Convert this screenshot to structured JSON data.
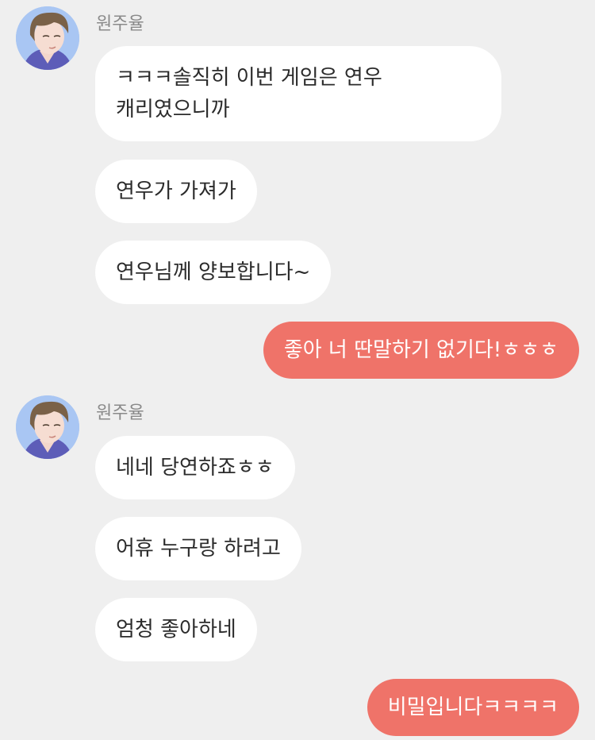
{
  "theme": {
    "background": "#efefef",
    "incoming_bubble": "#ffffff",
    "outgoing_bubble": "#ef7369",
    "sender_name_color": "#8a8a8a"
  },
  "groups": [
    {
      "sender": "원주율",
      "avatar_icon": "male-character-avatar",
      "messages": [
        "ㅋㅋㅋ솔직히 이번 게임은 연우 캐리였으니까",
        "연우가 가져가",
        "연우님께 양보합니다~"
      ]
    },
    {
      "sender": "원주율",
      "avatar_icon": "male-character-avatar",
      "messages": [
        "네네 당연하죠ㅎㅎ",
        "어휴 누구랑 하려고",
        "엄청 좋아하네"
      ]
    }
  ],
  "outgoing": [
    "좋아 너 딴말하기 없기다!ㅎㅎㅎ",
    "비밀입니다ㅋㅋㅋㅋ"
  ]
}
